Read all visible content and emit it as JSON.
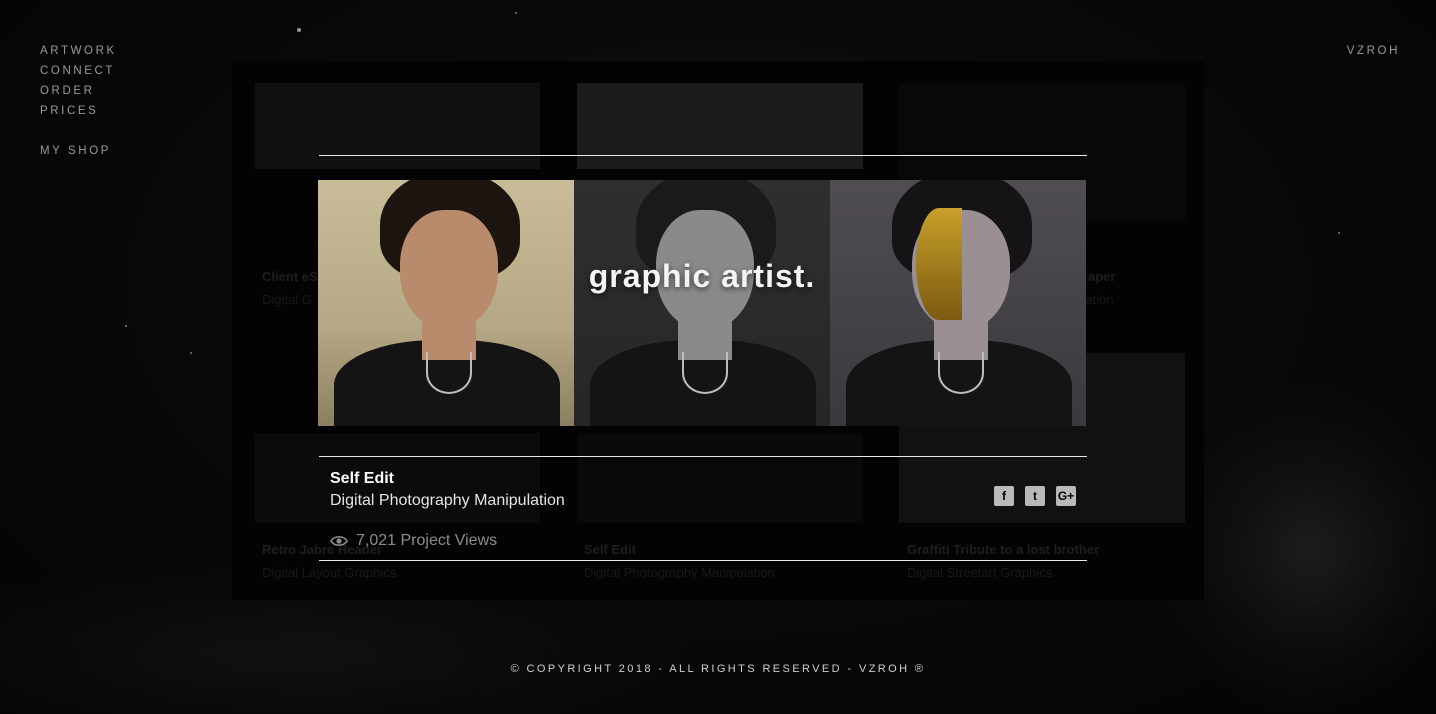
{
  "nav": {
    "items": [
      "ARTWORK",
      "CONNECT",
      "ORDER",
      "PRICES"
    ],
    "shop": "MY SHOP"
  },
  "brand": "VZROH",
  "grid": {
    "tiles": [
      {
        "title": "Client eS",
        "subtitle": "Digital G"
      },
      {
        "title": "aper",
        "subtitle": "pulation"
      },
      {
        "title": "Retro Jabre Header",
        "subtitle": "Digital Layout Graphics"
      },
      {
        "title": "Self Edit",
        "subtitle": "Digital Photography Manipulation"
      },
      {
        "title": "Graffiti Tribute to a lost brother",
        "subtitle": "Digital Streetart Graphics"
      }
    ]
  },
  "modal": {
    "hero_text": "graphic artist.",
    "title": "Self Edit",
    "subtitle": "Digital Photography Manipulation",
    "views": "7,021 Project Views",
    "social": [
      "facebook-icon",
      "twitter-icon",
      "google-plus-icon"
    ]
  },
  "footer": "© COPYRIGHT 2018 - ALL RIGHTS RESERVED - VZROH ®"
}
